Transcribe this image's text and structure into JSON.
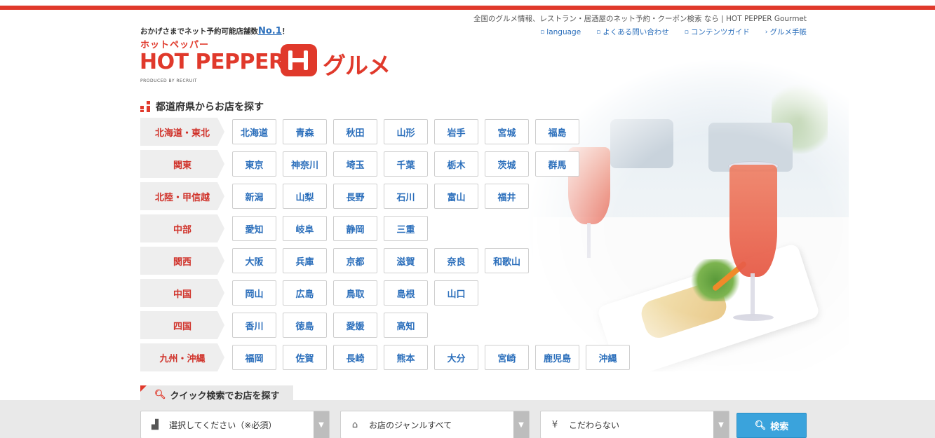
{
  "header": {
    "tagline": "全国のグルメ情報、レストラン・居酒屋のネット予約・クーポン検索 なら | HOT PEPPER Gourmet",
    "links": [
      {
        "label": "language"
      },
      {
        "label": "よくある問い合わせ"
      },
      {
        "label": "コンテンツガイド"
      },
      {
        "label": "グルメ手帳"
      }
    ]
  },
  "logo": {
    "catch_prefix": "おかげさまでネット予約可能店舗数",
    "catch_no1": "No.1",
    "catch_suffix": "！",
    "kana": "ホットペッパー",
    "main": "HOT PEPPER",
    "gourmet": "グルメ",
    "produced": "PRODUCED BY RECRUIT"
  },
  "area_search": {
    "title": "都道府県からお店を探す",
    "regions": [
      {
        "label": "北海道・東北",
        "prefs": [
          "北海道",
          "青森",
          "秋田",
          "山形",
          "岩手",
          "宮城",
          "福島"
        ]
      },
      {
        "label": "関東",
        "prefs": [
          "東京",
          "神奈川",
          "埼玉",
          "千葉",
          "栃木",
          "茨城",
          "群馬"
        ]
      },
      {
        "label": "北陸・甲信越",
        "prefs": [
          "新潟",
          "山梨",
          "長野",
          "石川",
          "富山",
          "福井"
        ]
      },
      {
        "label": "中部",
        "prefs": [
          "愛知",
          "岐阜",
          "静岡",
          "三重"
        ]
      },
      {
        "label": "関西",
        "prefs": [
          "大阪",
          "兵庫",
          "京都",
          "滋賀",
          "奈良",
          "和歌山"
        ]
      },
      {
        "label": "中国",
        "prefs": [
          "岡山",
          "広島",
          "鳥取",
          "島根",
          "山口"
        ]
      },
      {
        "label": "四国",
        "prefs": [
          "香川",
          "徳島",
          "愛媛",
          "高知"
        ]
      },
      {
        "label": "九州・沖縄",
        "prefs": [
          "福岡",
          "佐賀",
          "長崎",
          "熊本",
          "大分",
          "宮崎",
          "鹿児島",
          "沖縄"
        ]
      }
    ]
  },
  "quick_search": {
    "title": "クイック検索でお店を探す",
    "area_select": "選択してください（※必須）",
    "genre_select": "お店のジャンルすべて",
    "budget_select": "こだわらない",
    "budget_icon_glyph": "¥",
    "search_button": "検索"
  },
  "colors": {
    "brand_red": "#e0392b",
    "link_blue": "#2a6ebb",
    "button_blue": "#3aa3dc"
  }
}
